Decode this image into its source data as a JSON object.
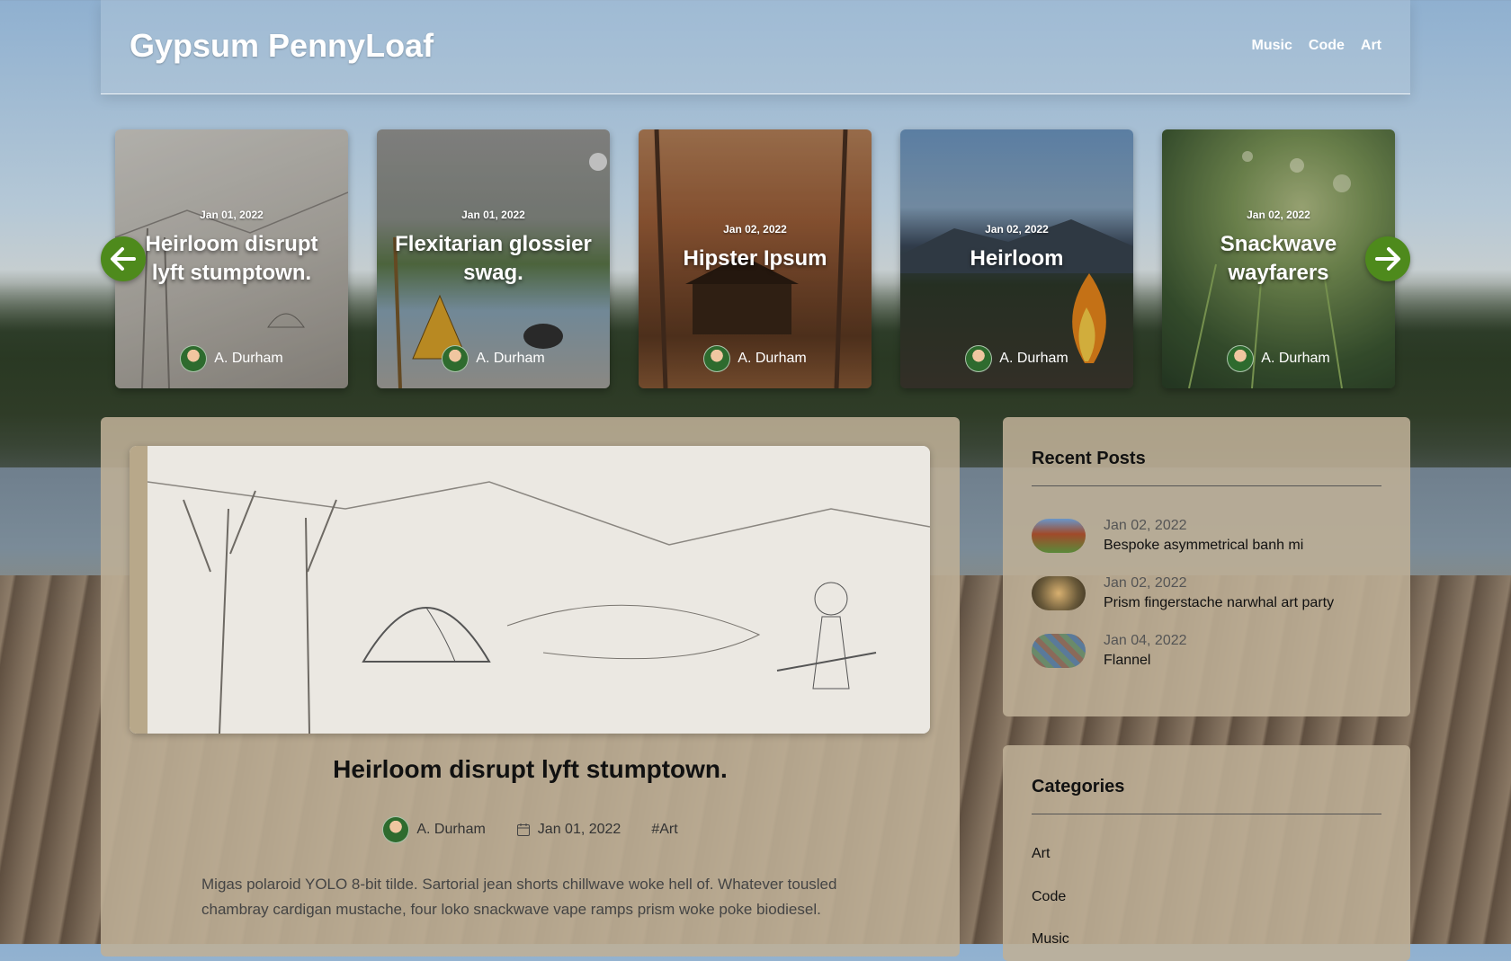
{
  "site": {
    "title": "Gypsum PennyLoaf"
  },
  "nav": [
    "Music",
    "Code",
    "Art"
  ],
  "carousel": {
    "cards": [
      {
        "date": "Jan 01, 2022",
        "title": "Heirloom disrupt lyft stumptown.",
        "author": "A. Durham"
      },
      {
        "date": "Jan 01, 2022",
        "title": "Flexitarian glossier swag.",
        "author": "A. Durham"
      },
      {
        "date": "Jan 02, 2022",
        "title": "Hipster Ipsum",
        "author": "A. Durham"
      },
      {
        "date": "Jan 02, 2022",
        "title": "Heirloom",
        "author": "A. Durham"
      },
      {
        "date": "Jan 02, 2022",
        "title": "Snackwave wayfarers",
        "author": "A. Durham"
      }
    ]
  },
  "article": {
    "title": "Heirloom disrupt lyft stumptown.",
    "author": "A. Durham",
    "date": "Jan 01, 2022",
    "tag": "#Art",
    "excerpt": "Migas polaroid YOLO 8-bit tilde. Sartorial jean shorts chillwave woke hell of. Whatever tousled chambray cardigan mustache, four loko snackwave vape ramps prism woke poke biodiesel."
  },
  "sidebar": {
    "recent": {
      "title": "Recent Posts",
      "posts": [
        {
          "date": "Jan 02, 2022",
          "title": "Bespoke asymmetrical banh mi"
        },
        {
          "date": "Jan 02, 2022",
          "title": "Prism fingerstache narwhal art party"
        },
        {
          "date": "Jan 04, 2022",
          "title": "Flannel"
        }
      ]
    },
    "categories": {
      "title": "Categories",
      "items": [
        "Art",
        "Code",
        "Music"
      ]
    }
  },
  "colors": {
    "accent": "#4e8a1c"
  },
  "icons": {
    "prev": "arrow-left-icon",
    "next": "arrow-right-icon",
    "date": "calendar-icon"
  }
}
